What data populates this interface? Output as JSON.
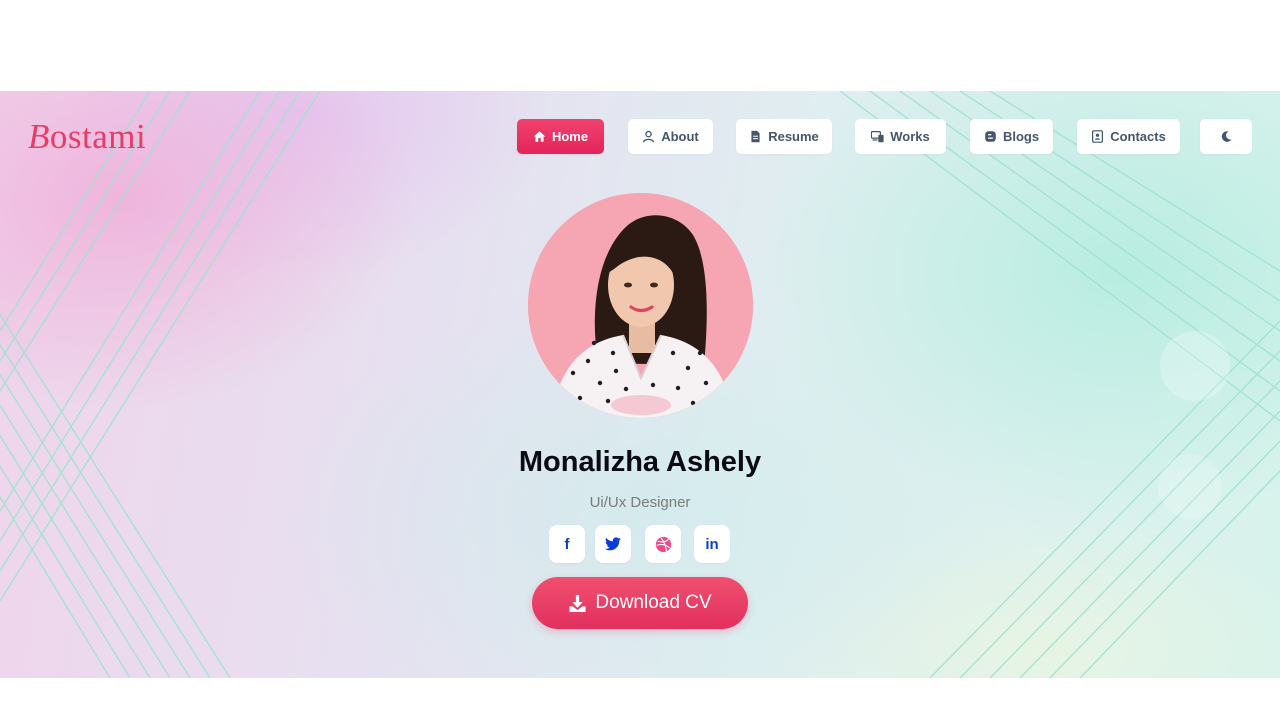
{
  "brand": {
    "logo_first": "B",
    "logo_rest": "ostami"
  },
  "nav": [
    {
      "label": "Home",
      "icon": "home-icon",
      "active": true
    },
    {
      "label": "About",
      "icon": "user-icon",
      "active": false
    },
    {
      "label": "Resume",
      "icon": "file-icon",
      "active": false
    },
    {
      "label": "Works",
      "icon": "devices-icon",
      "active": false
    },
    {
      "label": "Blogs",
      "icon": "blog-icon",
      "active": false
    },
    {
      "label": "Contacts",
      "icon": "contact-card-icon",
      "active": false
    }
  ],
  "theme_toggle": {
    "icon": "moon-icon"
  },
  "profile": {
    "name": "Monalizha Ashely",
    "role": "Ui/Ux Designer",
    "social": [
      {
        "name": "facebook-icon",
        "glyph": "f"
      },
      {
        "name": "twitter-icon",
        "glyph": ""
      },
      {
        "name": "dribbble-icon",
        "glyph": ""
      },
      {
        "name": "linkedin-icon",
        "glyph": "in"
      }
    ],
    "download_label": "Download CV"
  },
  "colors": {
    "accent": "#e63c66",
    "social_icon": "#0a3fd1",
    "dribbble": "#ea4c89"
  }
}
